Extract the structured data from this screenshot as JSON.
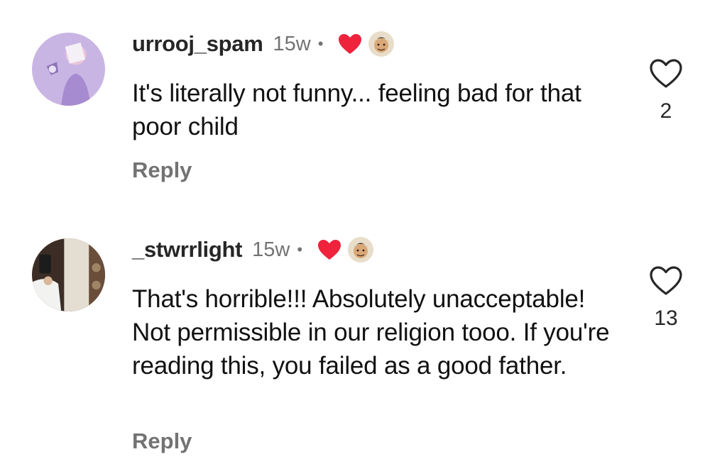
{
  "comments": [
    {
      "username": "urrooj_spam",
      "time": "15w",
      "separator": "•",
      "text": "It's literally not funny... feeling bad for that poor child",
      "reply_label": "Reply",
      "likes": "2",
      "liked_by_creator": true,
      "avatar_colors": {
        "bg": "#c7b3e2",
        "accent": "#9f86c9"
      }
    },
    {
      "username": "_stwrrlight",
      "time": "15w",
      "separator": "•",
      "text": "That's horrible!!! Absolutely unacceptable! Not permissible in our religion tooo. If you're reading this, you failed as a good father.",
      "reply_label": "Reply",
      "likes": "13",
      "liked_by_creator": true,
      "avatar_colors": {
        "bg": "#3a2c24",
        "accent": "#d9d2c8"
      }
    }
  ],
  "icons": {
    "like": "heart-outline-icon",
    "creator_like": "filled-heart-icon"
  },
  "colors": {
    "creator_heart": "#ef233c",
    "secondary_text": "#737373"
  }
}
